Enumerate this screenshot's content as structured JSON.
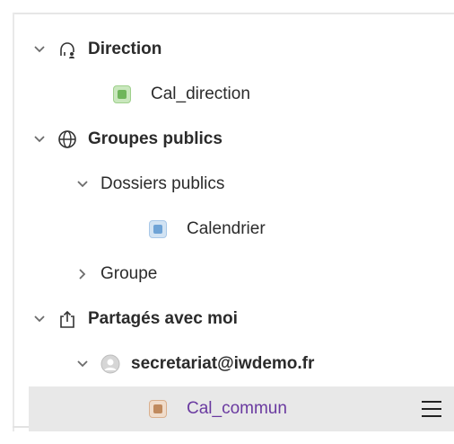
{
  "tree": {
    "direction": {
      "label": "Direction",
      "children": [
        {
          "label": "Cal_direction",
          "color": "#8fc77e",
          "dot": "#6fb55b"
        }
      ]
    },
    "groupes_publics": {
      "label": "Groupes publics",
      "dossiers_publics": {
        "label": "Dossiers publics",
        "children": [
          {
            "label": "Calendrier",
            "color": "#a9c8e8",
            "dot": "#6fa3d6"
          }
        ]
      },
      "groupe": {
        "label": "Groupe"
      }
    },
    "partages": {
      "label": "Partagés avec moi",
      "account": {
        "label": "secretariat@iwdemo.fr",
        "children": [
          {
            "label": "Cal_commun",
            "color": "#e3c2a6",
            "dot": "#c08a5e",
            "selected": true
          }
        ]
      }
    }
  },
  "colors": {
    "selected_background": "#e8e8e8",
    "selected_text": "#6a3aa0"
  }
}
